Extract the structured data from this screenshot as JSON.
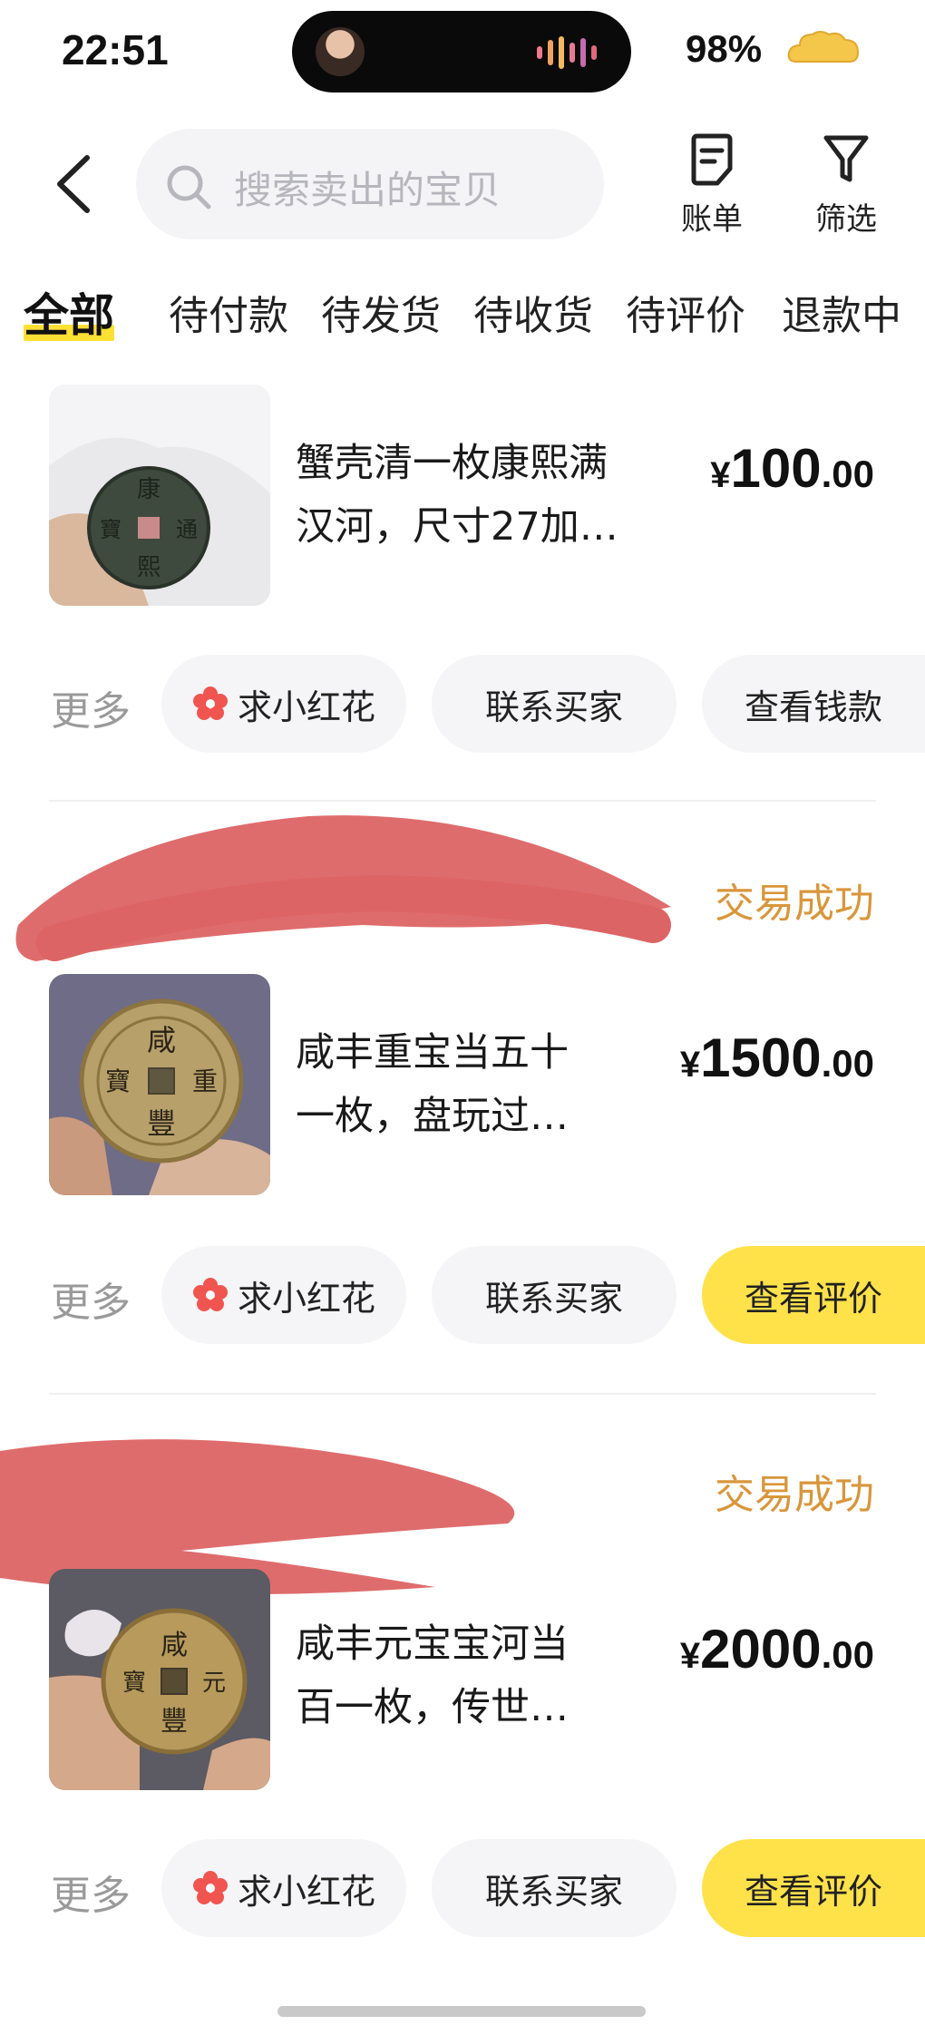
{
  "status_bar": {
    "time": "22:51",
    "battery": "98%"
  },
  "header": {
    "search_placeholder": "搜索卖出的宝贝",
    "bill_label": "账单",
    "filter_label": "筛选"
  },
  "tabs": [
    {
      "label": "全部",
      "active": true
    },
    {
      "label": "待付款"
    },
    {
      "label": "待发货"
    },
    {
      "label": "待收货"
    },
    {
      "label": "待评价"
    },
    {
      "label": "退款中"
    }
  ],
  "orders": [
    {
      "title": "蟹壳清一枚康熙满汉河，尺寸27加…",
      "title_line1": "蟹壳清一枚康熙满",
      "title_line2": "汉河，尺寸27加…",
      "price_symbol": "¥",
      "price_int": "100",
      "price_dec": ".00",
      "status": "",
      "more": "更多",
      "actions": [
        "求小红花",
        "联系买家",
        "查看钱款"
      ]
    },
    {
      "title": "咸丰重宝当五十一枚，盘玩过…",
      "title_line1": "咸丰重宝当五十",
      "title_line2": "一枚，盘玩过…",
      "price_symbol": "¥",
      "price_int": "1500",
      "price_dec": ".00",
      "status": "交易成功",
      "more": "更多",
      "actions": [
        "求小红花",
        "联系买家",
        "查看评价"
      ]
    },
    {
      "title": "咸丰元宝宝河当百一枚，传世…",
      "title_line1": "咸丰元宝宝河当",
      "title_line2": "百一枚，传世…",
      "price_symbol": "¥",
      "price_int": "2000",
      "price_dec": ".00",
      "status": "交易成功",
      "more": "更多",
      "actions": [
        "求小红花",
        "联系买家",
        "查看评价"
      ]
    }
  ],
  "colors": {
    "accent_yellow": "#ffe14a",
    "status_orange": "#d9963a",
    "flower_red": "#f0554f"
  }
}
